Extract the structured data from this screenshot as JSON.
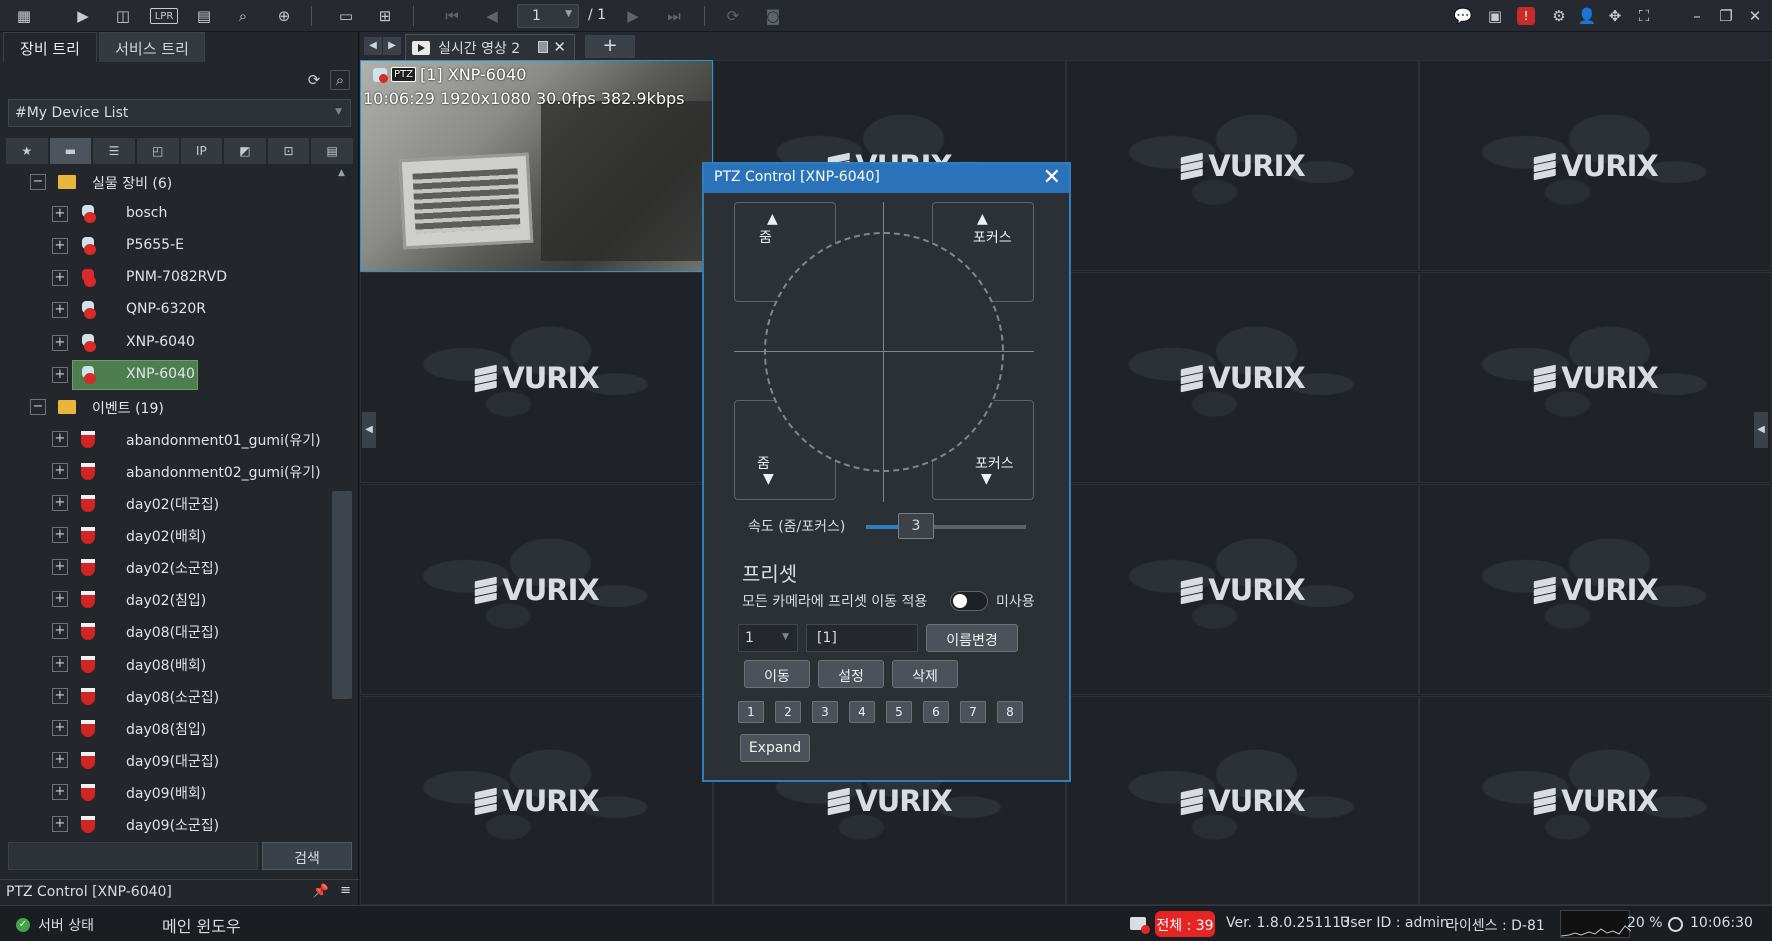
{
  "toolbar": {
    "icons": [
      "grid-menu-icon",
      "live-video-icon",
      "playback-search-icon",
      "lpr-icon",
      "event-search-icon",
      "device-search-icon",
      "map-icon",
      "layout-icon",
      "add-layout-icon",
      "first-page-icon",
      "prev-page-icon",
      "next-page-icon",
      "last-page-icon",
      "sequence-icon",
      "snapshot-icon"
    ],
    "lpr_label": "LPR",
    "page_current": "1",
    "page_total": "/ 1",
    "right_icons": [
      "chat-icon",
      "monitor-icon",
      "alarm-icon",
      "settings-icon",
      "user-icon",
      "move-icon",
      "fullscreen-icon",
      "minimize-icon",
      "restore-icon",
      "close-icon"
    ]
  },
  "sidebar": {
    "tabs": [
      "장비 트리",
      "서비스 트리"
    ],
    "device_list": "#My Device List",
    "filters": [
      "★",
      "",
      "",
      "",
      "IP",
      "",
      "",
      ""
    ],
    "tree": [
      {
        "type": "folder",
        "label": "실물 장비 (6)",
        "level": 0,
        "expanded": true
      },
      {
        "type": "device",
        "label": "bosch",
        "level": 1
      },
      {
        "type": "device",
        "label": "P5655-E",
        "level": 1
      },
      {
        "type": "device-error",
        "label": "PNM-7082RVD",
        "level": 1
      },
      {
        "type": "device",
        "label": "QNP-6320R",
        "level": 1
      },
      {
        "type": "device",
        "label": "XNP-6040",
        "level": 1
      },
      {
        "type": "device",
        "label": "XNP-6040",
        "level": 1,
        "selected": true
      },
      {
        "type": "folder",
        "label": "이벤트 (19)",
        "level": 0,
        "expanded": true
      },
      {
        "type": "event",
        "label": "abandonment01_gumi(유기)",
        "level": 1
      },
      {
        "type": "event",
        "label": "abandonment02_gumi(유기)",
        "level": 1
      },
      {
        "type": "event",
        "label": "day02(대군집)",
        "level": 1
      },
      {
        "type": "event",
        "label": "day02(배회)",
        "level": 1
      },
      {
        "type": "event",
        "label": "day02(소군집)",
        "level": 1
      },
      {
        "type": "event",
        "label": "day02(침입)",
        "level": 1
      },
      {
        "type": "event",
        "label": "day08(대군집)",
        "level": 1
      },
      {
        "type": "event",
        "label": "day08(배회)",
        "level": 1
      },
      {
        "type": "event",
        "label": "day08(소군집)",
        "level": 1
      },
      {
        "type": "event",
        "label": "day08(침입)",
        "level": 1
      },
      {
        "type": "event",
        "label": "day09(대군집)",
        "level": 1
      },
      {
        "type": "event",
        "label": "day09(배회)",
        "level": 1
      },
      {
        "type": "event",
        "label": "day09(소군집)",
        "level": 1
      }
    ],
    "search_button": "검색",
    "panel_title": "PTZ Control [XNP-6040]"
  },
  "view": {
    "tab_label": "실시간 영상 2",
    "add_tab": "+",
    "video": {
      "ptz_badge": "PTZ",
      "camera": "[1] XNP-6040",
      "info": "10:06:29 1920x1080 30.0fps 382.9kbps"
    },
    "placeholder_logo": "VURIX"
  },
  "ptz": {
    "title": "PTZ Control  [XNP-6040]",
    "zoom_in": "줌",
    "focus_in": "포커스",
    "zoom_out": "줌",
    "focus_out": "포커스",
    "speed_label": "속도 (줌/포커스)",
    "speed_value": "3",
    "speed_fraction": 0.2,
    "preset_heading": "프리셋",
    "apply_all_label": "모든 카메라에 프리셋 이동 적용",
    "toggle_state": "미사용",
    "preset_number": "1",
    "preset_name": "[1]",
    "rename_button": "이름변경",
    "move_button": "이동",
    "set_button": "설정",
    "delete_button": "삭제",
    "quick_presets": [
      "1",
      "2",
      "3",
      "4",
      "5",
      "6",
      "7",
      "8"
    ],
    "expand_button": "Expand"
  },
  "status": {
    "server_state": "서버 상태",
    "main_window": "메인 윈도우",
    "total_badge": "전체 : 39",
    "version": "Ver. 1.8.0.251113",
    "user": "User ID : admin",
    "license": "라이센스 : D-81",
    "cpu": "20 %",
    "time": "10:06:30"
  },
  "colors": {
    "accent": "#2a73b9",
    "alert": "#e52424",
    "selected": "#4e7d4f",
    "ok": "#3fa547"
  }
}
